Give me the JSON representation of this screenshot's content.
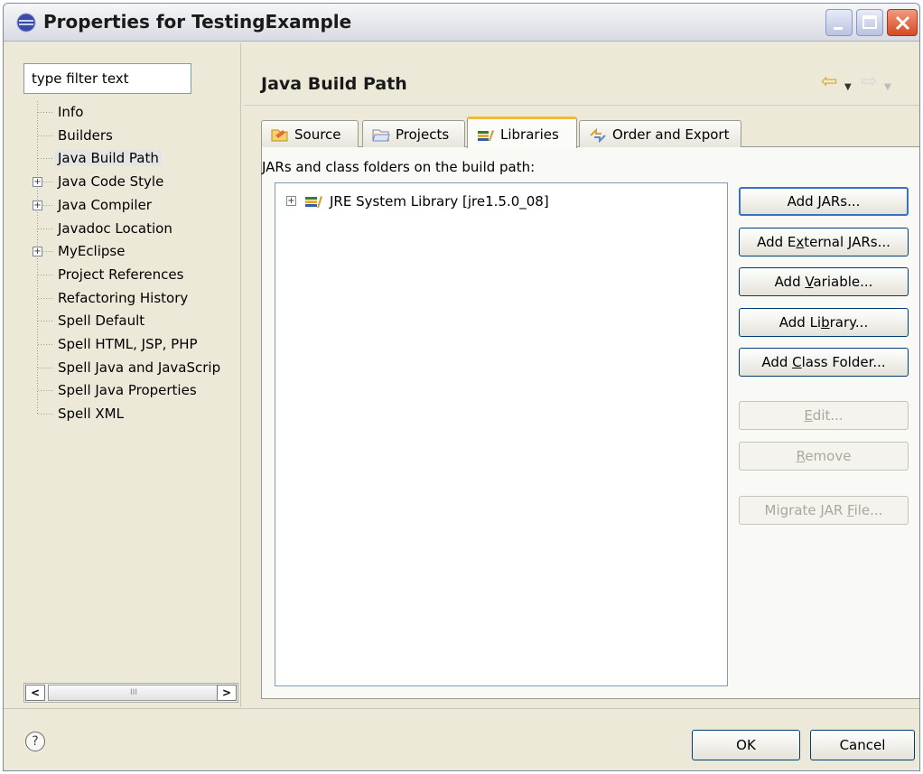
{
  "window": {
    "title": "Properties for TestingExample"
  },
  "filter": {
    "value": "type filter text"
  },
  "tree": {
    "items": [
      {
        "label": "Info",
        "expandable": false,
        "selected": false
      },
      {
        "label": "Builders",
        "expandable": false,
        "selected": false
      },
      {
        "label": "Java Build Path",
        "expandable": false,
        "selected": true
      },
      {
        "label": "Java Code Style",
        "expandable": true,
        "selected": false
      },
      {
        "label": "Java Compiler",
        "expandable": true,
        "selected": false
      },
      {
        "label": "Javadoc Location",
        "expandable": false,
        "selected": false
      },
      {
        "label": "MyEclipse",
        "expandable": true,
        "selected": false
      },
      {
        "label": "Project References",
        "expandable": false,
        "selected": false
      },
      {
        "label": "Refactoring History",
        "expandable": false,
        "selected": false
      },
      {
        "label": "Spell Default",
        "expandable": false,
        "selected": false
      },
      {
        "label": "Spell HTML, JSP, PHP",
        "expandable": false,
        "selected": false
      },
      {
        "label": "Spell Java and JavaScrip",
        "expandable": false,
        "selected": false
      },
      {
        "label": "Spell Java Properties",
        "expandable": false,
        "selected": false
      },
      {
        "label": "Spell XML",
        "expandable": false,
        "selected": false
      }
    ],
    "scroll_thumb": "III"
  },
  "page": {
    "title": "Java Build Path",
    "tabs": [
      {
        "label": "Source",
        "icon": "source-folder-icon",
        "active": false
      },
      {
        "label": "Projects",
        "icon": "projects-folder-icon",
        "active": false
      },
      {
        "label": "Libraries",
        "icon": "libraries-icon",
        "active": true
      },
      {
        "label": "Order and Export",
        "icon": "order-export-icon",
        "active": false
      }
    ],
    "description": "JARs and class folders on the build path:",
    "libraries": [
      {
        "label": "JRE System Library [jre1.5.0_08]",
        "icon": "library-icon"
      }
    ],
    "buttons": {
      "add_jars": {
        "pre": "Add ",
        "mn": "J",
        "post": "ARs..."
      },
      "add_external_jars": {
        "pre": "Add E",
        "mn": "x",
        "post": "ternal JARs..."
      },
      "add_variable": {
        "pre": "Add ",
        "mn": "V",
        "post": "ariable..."
      },
      "add_library": {
        "pre": "Add Li",
        "mn": "b",
        "post": "rary..."
      },
      "add_class_folder": {
        "pre": "Add ",
        "mn": "C",
        "post": "lass Folder..."
      },
      "edit": {
        "pre": "",
        "mn": "E",
        "post": "dit..."
      },
      "remove": {
        "pre": "",
        "mn": "R",
        "post": "emove"
      },
      "migrate": {
        "pre": "Migrate JAR ",
        "mn": "F",
        "post": "ile..."
      }
    }
  },
  "footer": {
    "help": "?",
    "ok": "OK",
    "cancel": "Cancel"
  },
  "colors": {
    "accent_tab": "#f0b93a",
    "button_border": "#003c74",
    "disabled_text": "#a9a89c"
  }
}
